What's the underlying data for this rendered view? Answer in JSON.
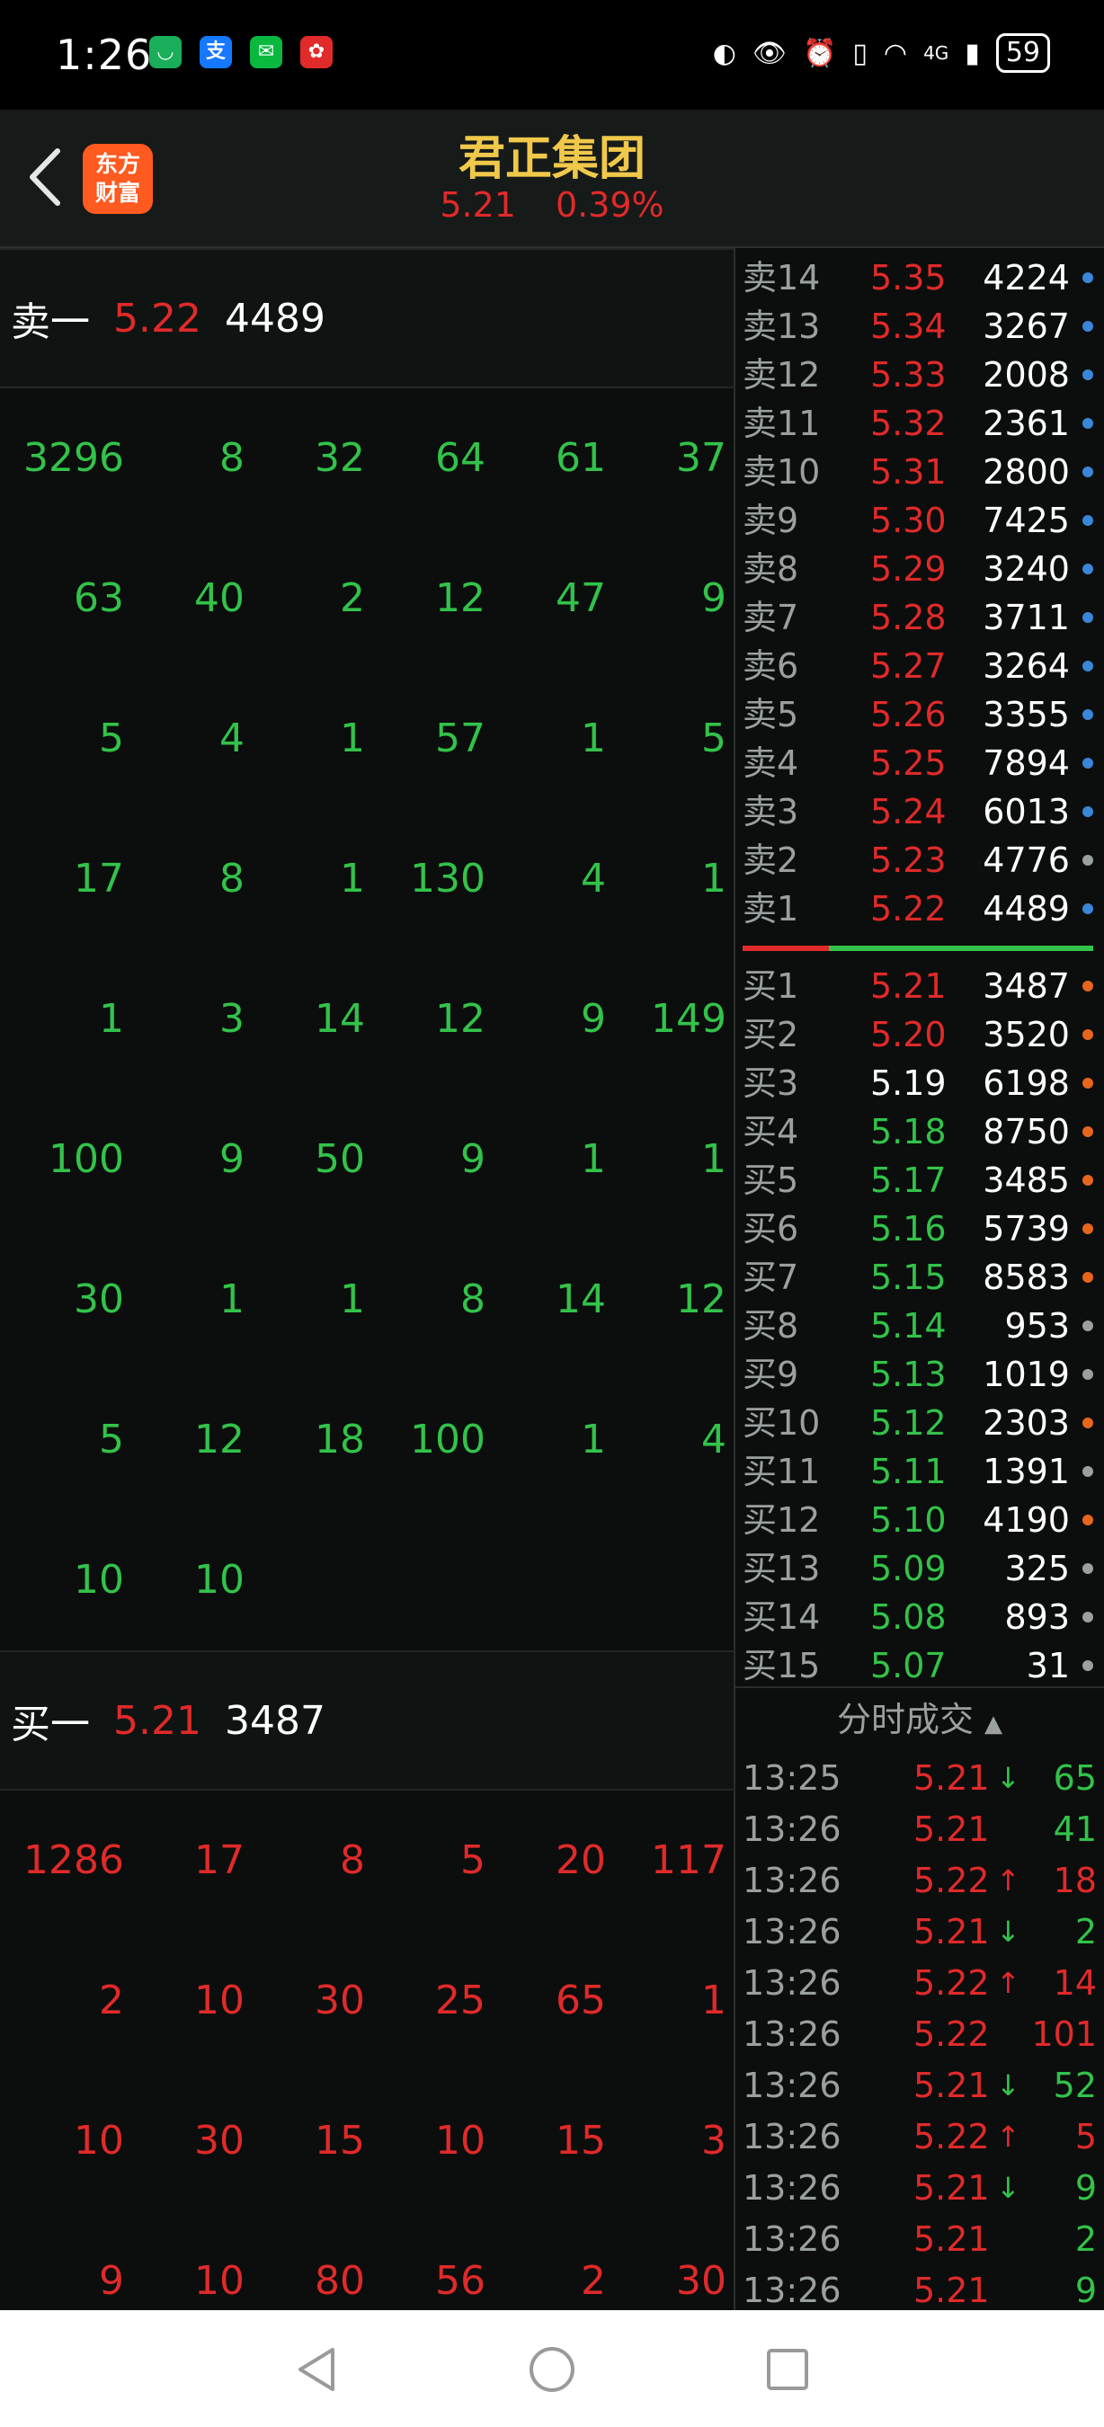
{
  "status_bar": {
    "time": "1:26",
    "battery": "59",
    "network": "4G",
    "app_icons": [
      "wechat-miniapp-icon",
      "alipay-icon",
      "wechat-icon",
      "tmall-icon"
    ]
  },
  "header": {
    "title": "君正集团",
    "price": "5.21",
    "change_pct": "0.39%"
  },
  "logo": {
    "line1": "东方",
    "line2": "财富"
  },
  "left_panel": {
    "sell1": {
      "label": "卖一",
      "price": "5.22",
      "volume": "4489"
    },
    "sell_queue": [
      [
        "3296",
        "8",
        "32",
        "64",
        "61",
        "37"
      ],
      [
        "63",
        "40",
        "2",
        "12",
        "47",
        "9"
      ],
      [
        "5",
        "4",
        "1",
        "57",
        "1",
        "5"
      ],
      [
        "17",
        "8",
        "1",
        "130",
        "4",
        "1"
      ],
      [
        "1",
        "3",
        "14",
        "12",
        "9",
        "149"
      ],
      [
        "100",
        "9",
        "50",
        "9",
        "1",
        "1"
      ],
      [
        "30",
        "1",
        "1",
        "8",
        "14",
        "12"
      ],
      [
        "5",
        "12",
        "18",
        "100",
        "1",
        "4"
      ],
      [
        "10",
        "10",
        "",
        "",
        "",
        ""
      ]
    ],
    "buy1": {
      "label": "买一",
      "price": "5.21",
      "volume": "3487"
    },
    "buy_queue": [
      [
        "1286",
        "17",
        "8",
        "5",
        "20",
        "117"
      ],
      [
        "2",
        "10",
        "30",
        "25",
        "65",
        "1"
      ],
      [
        "10",
        "30",
        "15",
        "10",
        "15",
        "3"
      ],
      [
        "9",
        "10",
        "80",
        "56",
        "2",
        "30"
      ]
    ]
  },
  "order_book": {
    "asks": [
      {
        "label": "卖14",
        "price": "5.35",
        "volume": "4224",
        "dot": "blue"
      },
      {
        "label": "卖13",
        "price": "5.34",
        "volume": "3267",
        "dot": "blue"
      },
      {
        "label": "卖12",
        "price": "5.33",
        "volume": "2008",
        "dot": "blue"
      },
      {
        "label": "卖11",
        "price": "5.32",
        "volume": "2361",
        "dot": "blue"
      },
      {
        "label": "卖10",
        "price": "5.31",
        "volume": "2800",
        "dot": "blue"
      },
      {
        "label": "卖9",
        "price": "5.30",
        "volume": "7425",
        "dot": "blue"
      },
      {
        "label": "卖8",
        "price": "5.29",
        "volume": "3240",
        "dot": "blue"
      },
      {
        "label": "卖7",
        "price": "5.28",
        "volume": "3711",
        "dot": "blue"
      },
      {
        "label": "卖6",
        "price": "5.27",
        "volume": "3264",
        "dot": "blue"
      },
      {
        "label": "卖5",
        "price": "5.26",
        "volume": "3355",
        "dot": "blue"
      },
      {
        "label": "卖4",
        "price": "5.25",
        "volume": "7894",
        "dot": "blue"
      },
      {
        "label": "卖3",
        "price": "5.24",
        "volume": "6013",
        "dot": "blue"
      },
      {
        "label": "卖2",
        "price": "5.23",
        "volume": "4776",
        "dot": "gray"
      },
      {
        "label": "卖1",
        "price": "5.22",
        "volume": "4489",
        "dot": "blue"
      }
    ],
    "bids": [
      {
        "label": "买1",
        "price": "5.21",
        "volume": "3487",
        "dot": "orange",
        "color": "red"
      },
      {
        "label": "买2",
        "price": "5.20",
        "volume": "3520",
        "dot": "orange",
        "color": "red"
      },
      {
        "label": "买3",
        "price": "5.19",
        "volume": "6198",
        "dot": "orange",
        "color": "white"
      },
      {
        "label": "买4",
        "price": "5.18",
        "volume": "8750",
        "dot": "orange",
        "color": "green"
      },
      {
        "label": "买5",
        "price": "5.17",
        "volume": "3485",
        "dot": "orange",
        "color": "green"
      },
      {
        "label": "买6",
        "price": "5.16",
        "volume": "5739",
        "dot": "orange",
        "color": "green"
      },
      {
        "label": "买7",
        "price": "5.15",
        "volume": "8583",
        "dot": "orange",
        "color": "green"
      },
      {
        "label": "买8",
        "price": "5.14",
        "volume": "953",
        "dot": "gray",
        "color": "green"
      },
      {
        "label": "买9",
        "price": "5.13",
        "volume": "1019",
        "dot": "gray",
        "color": "green"
      },
      {
        "label": "买10",
        "price": "5.12",
        "volume": "2303",
        "dot": "orange",
        "color": "green"
      },
      {
        "label": "买11",
        "price": "5.11",
        "volume": "1391",
        "dot": "gray",
        "color": "green"
      },
      {
        "label": "买12",
        "price": "5.10",
        "volume": "4190",
        "dot": "orange",
        "color": "green"
      },
      {
        "label": "买13",
        "price": "5.09",
        "volume": "325",
        "dot": "gray",
        "color": "green"
      },
      {
        "label": "买14",
        "price": "5.08",
        "volume": "893",
        "dot": "gray",
        "color": "green"
      },
      {
        "label": "买15",
        "price": "5.07",
        "volume": "31",
        "dot": "gray",
        "color": "green"
      }
    ]
  },
  "trades": {
    "header": "分时成交",
    "rows": [
      {
        "time": "13:25",
        "price": "5.21",
        "arrow": "↓",
        "volume": "65",
        "vol_color": "green"
      },
      {
        "time": "13:26",
        "price": "5.21",
        "arrow": "",
        "volume": "41",
        "vol_color": "green"
      },
      {
        "time": "13:26",
        "price": "5.22",
        "arrow": "↑",
        "volume": "18",
        "vol_color": "red"
      },
      {
        "time": "13:26",
        "price": "5.21",
        "arrow": "↓",
        "volume": "2",
        "vol_color": "green"
      },
      {
        "time": "13:26",
        "price": "5.22",
        "arrow": "↑",
        "volume": "14",
        "vol_color": "red"
      },
      {
        "time": "13:26",
        "price": "5.22",
        "arrow": "",
        "volume": "101",
        "vol_color": "red"
      },
      {
        "time": "13:26",
        "price": "5.21",
        "arrow": "↓",
        "volume": "52",
        "vol_color": "green"
      },
      {
        "time": "13:26",
        "price": "5.22",
        "arrow": "↑",
        "volume": "5",
        "vol_color": "red"
      },
      {
        "time": "13:26",
        "price": "5.21",
        "arrow": "↓",
        "volume": "9",
        "vol_color": "green"
      },
      {
        "time": "13:26",
        "price": "5.21",
        "arrow": "",
        "volume": "2",
        "vol_color": "green"
      },
      {
        "time": "13:26",
        "price": "5.21",
        "arrow": "",
        "volume": "9",
        "vol_color": "green"
      }
    ]
  },
  "colors": {
    "red": "#e02a2a",
    "green": "#33c24a",
    "gold": "#f0c84a",
    "blue": "#3a86d8",
    "orange": "#e8651e"
  }
}
